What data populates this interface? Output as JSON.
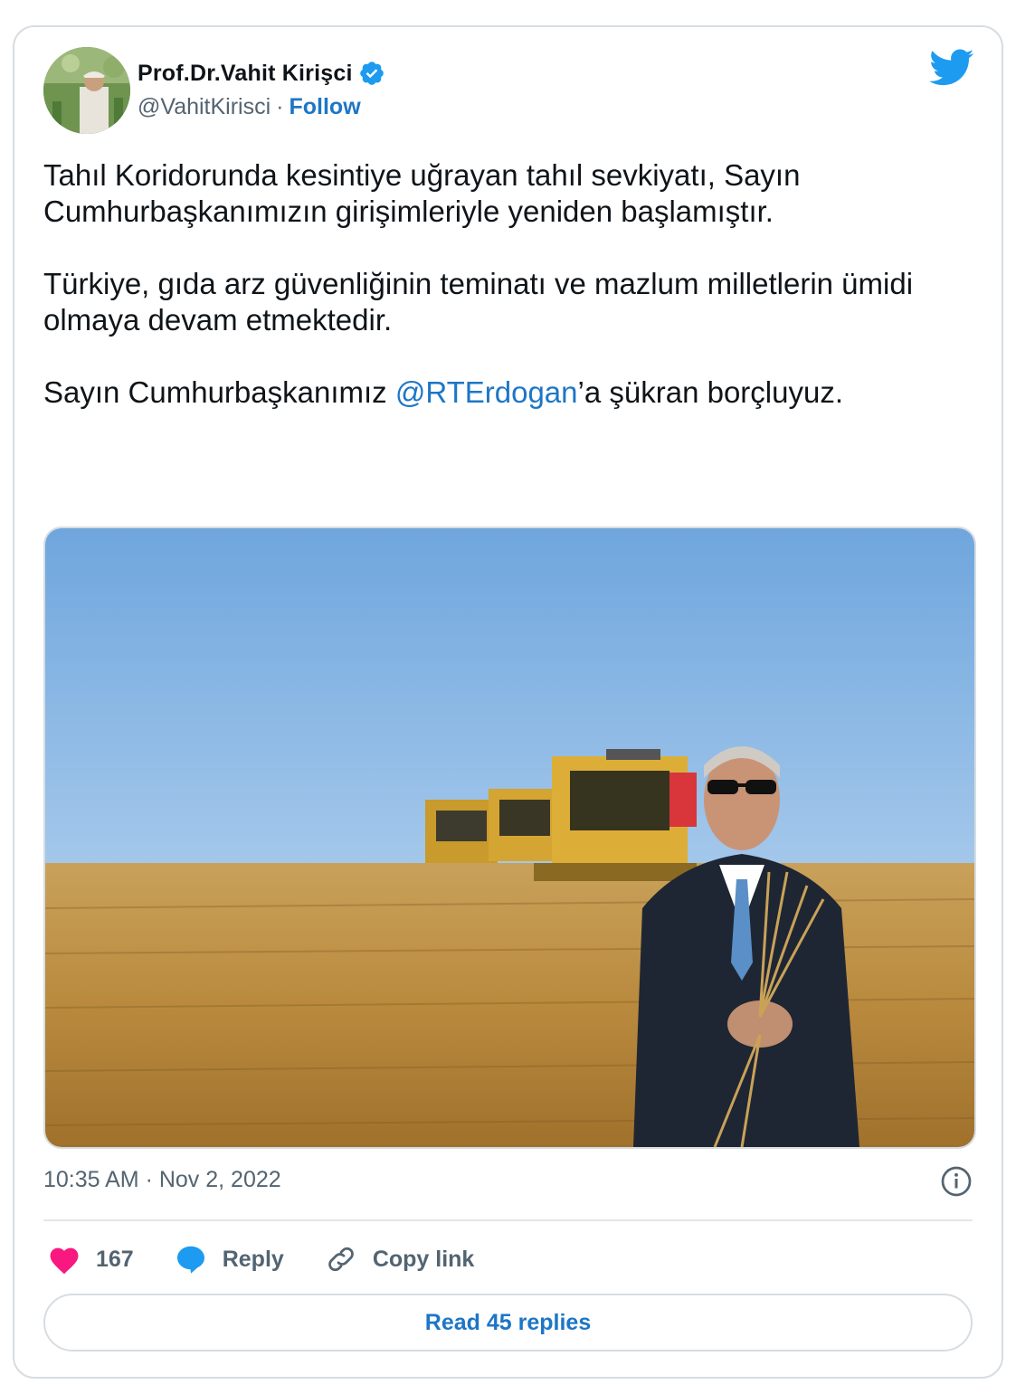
{
  "author": {
    "display_name": "Prof.Dr.Vahit Kirişci",
    "handle": "@VahitKirisci",
    "separator": "·",
    "follow_label": "Follow",
    "avatar_icon": "profile-photo"
  },
  "tweet": {
    "paragraph_1": "Tahıl Koridorunda kesintiye uğrayan tahıl sevkiyatı, Sayın Cumhurbaşkanımızın girişimleriyle yeniden başlamıştır.",
    "paragraph_2": "Türkiye, gıda arz güvenliğinin teminatı ve mazlum milletlerin ümidi olmaya devam etmektedir.",
    "paragraph_3_before": "Sayın Cumhurbaşkanımız ",
    "mention": "@RTErdogan",
    "paragraph_3_after": "’a şükran borçluyuz."
  },
  "timestamp": "10:35 AM · Nov 2, 2022",
  "actions": {
    "like_count": "167",
    "reply_label": "Reply",
    "copy_link_label": "Copy link"
  },
  "read_replies_label": "Read 45 replies",
  "colors": {
    "accent": "#1d76c6",
    "twitter_blue": "#1d9bf0",
    "like_pink": "#f91880",
    "muted": "#536471"
  }
}
